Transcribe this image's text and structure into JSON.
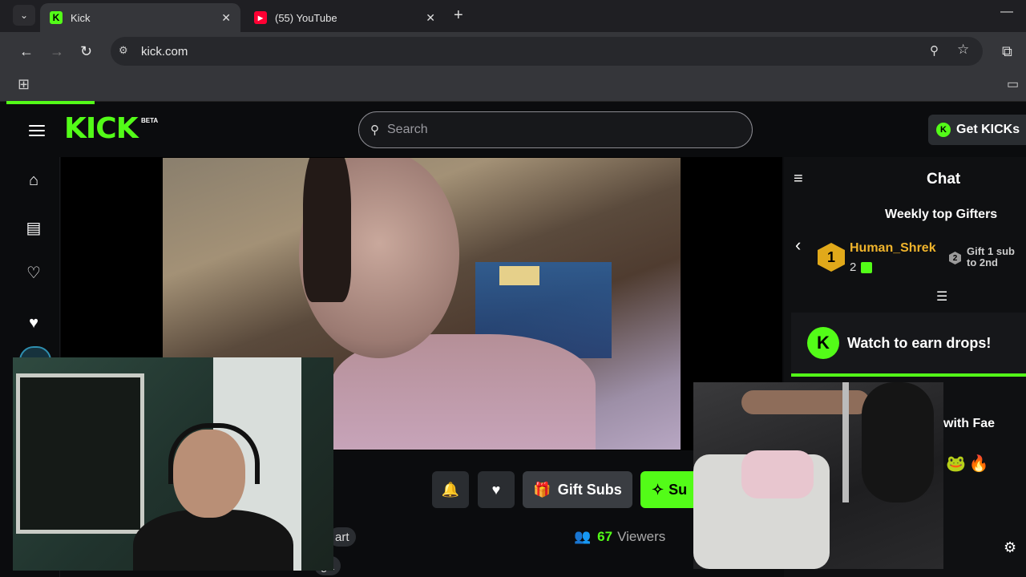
{
  "browser": {
    "tabs": [
      {
        "title": "Kick",
        "active": true
      },
      {
        "title": "(55) YouTube",
        "active": false
      }
    ],
    "url": "kick.com"
  },
  "header": {
    "logo_text": "KICK",
    "beta_label": "BETA",
    "search_placeholder": "Search",
    "get_kicks_label": "Get KICKs"
  },
  "actions": {
    "gift_subs_label": "Gift Subs",
    "subscribe_label": "Su"
  },
  "stream": {
    "viewer_count": "67",
    "viewers_label": "Viewers",
    "tags": [
      "art",
      "ga"
    ]
  },
  "chat": {
    "title": "Chat",
    "weekly_gifters_title": "Weekly top Gifters",
    "top_gifter": {
      "name": "Human_Shrek",
      "count": "2",
      "rank": "1"
    },
    "second_gifter": {
      "rank": "2",
      "text": "Gift 1 sub to 2nd"
    },
    "drops_banner": "Watch to earn drops!",
    "message_fragment": "with Fae"
  },
  "colors": {
    "accent": "#53fc18",
    "background": "#0b0c0e",
    "gifter_gold": "#f0b42c"
  }
}
